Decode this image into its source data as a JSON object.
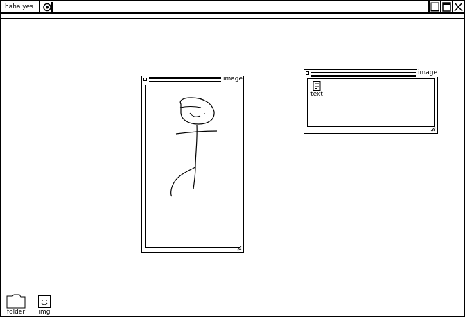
{
  "topbar": {
    "tab_label": "haha yes",
    "controls": {
      "minimize": "minimize-icon",
      "maximize": "maximize-icon",
      "close": "close-icon"
    }
  },
  "windows": {
    "image_window": {
      "title": "image"
    },
    "text_window": {
      "title": "image",
      "files": [
        {
          "label": "text",
          "icon": "text-file-icon"
        }
      ]
    }
  },
  "desktop": {
    "icons": [
      {
        "label": "folder",
        "icon": "folder-icon"
      },
      {
        "label": "img",
        "icon": "image-file-icon"
      }
    ]
  }
}
